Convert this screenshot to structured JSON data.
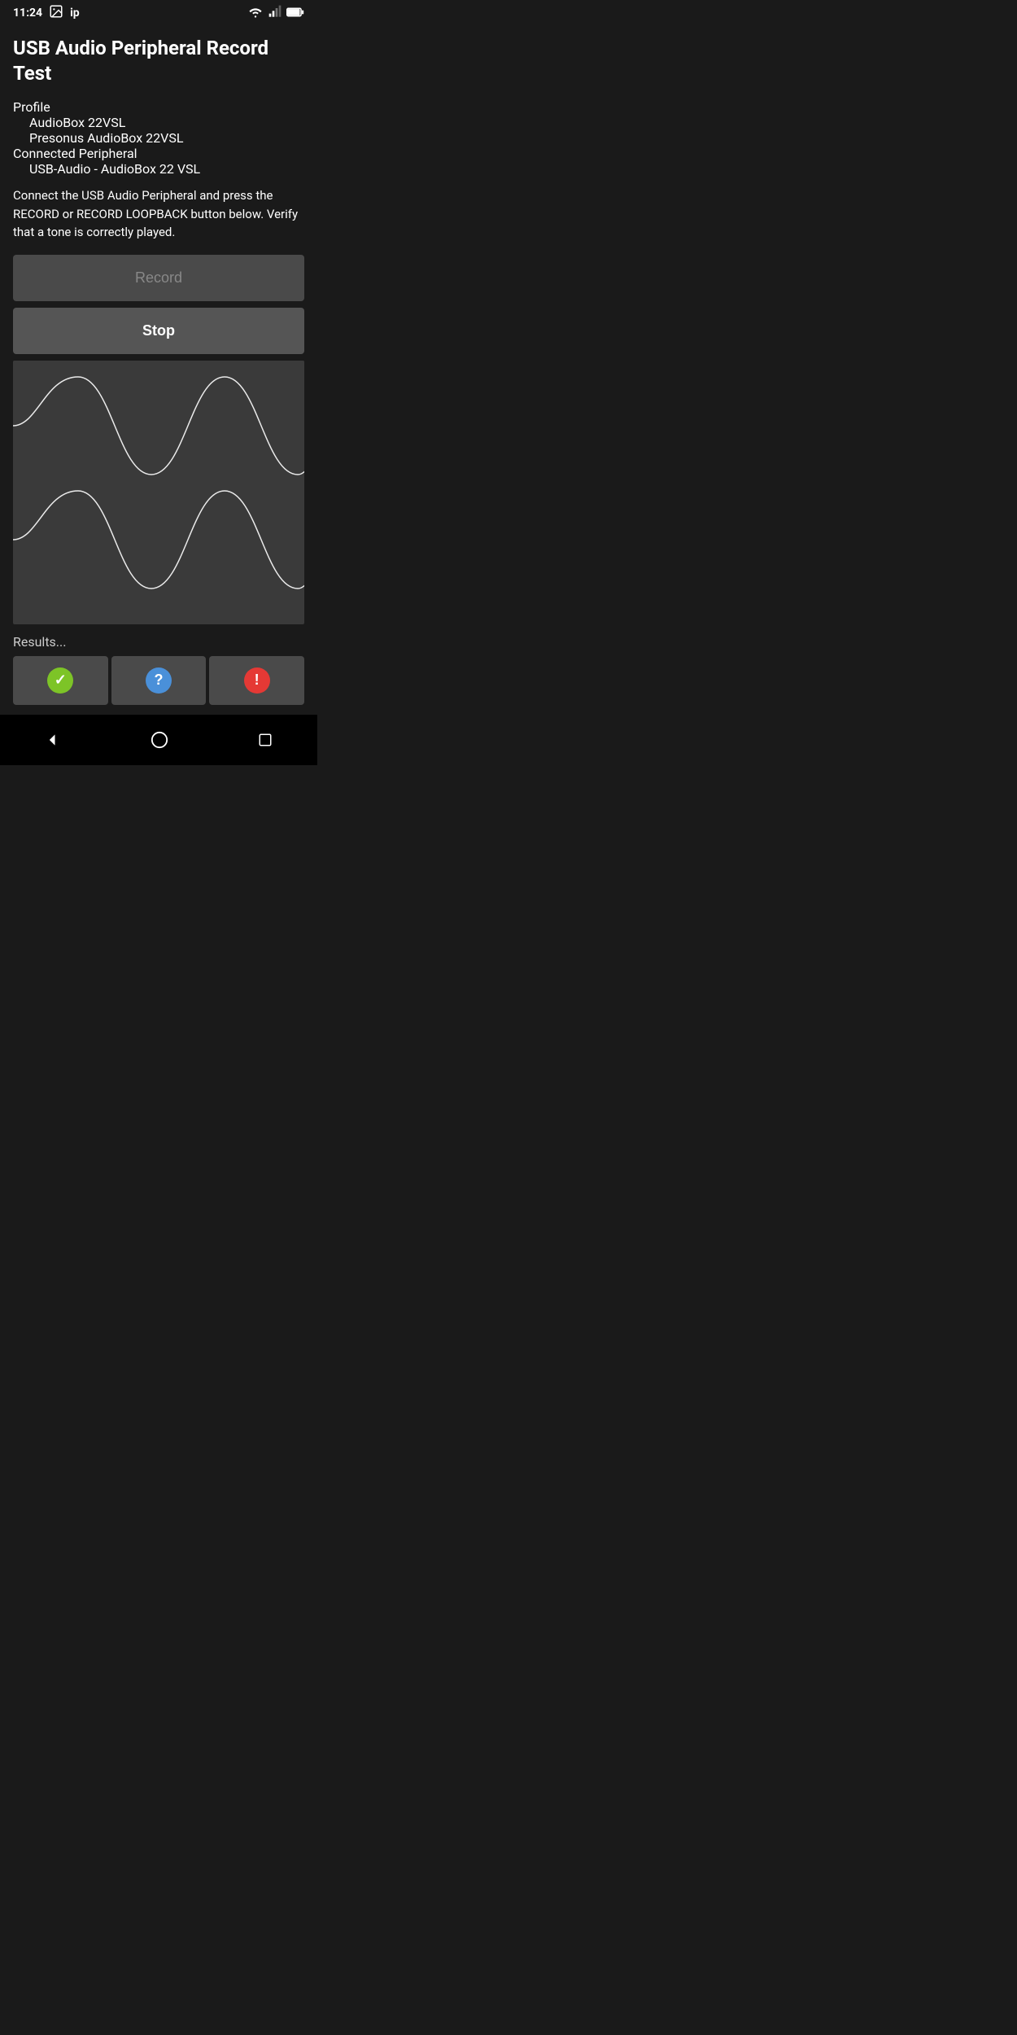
{
  "status_bar": {
    "time": "11:24",
    "notification_icon": "image",
    "network_label": "ip"
  },
  "header": {
    "title": "USB Audio Peripheral Record Test"
  },
  "profile": {
    "label": "Profile",
    "audiobox_name": "AudioBox 22VSL",
    "presonus_name": "Presonus AudioBox 22VSL"
  },
  "peripheral": {
    "label": "Connected Peripheral",
    "device_name": "USB-Audio - AudioBox 22 VSL"
  },
  "description": "Connect the USB Audio Peripheral and press the RECORD or RECORD LOOPBACK button below. Verify that a tone is correctly played.",
  "buttons": {
    "record_label": "Record",
    "stop_label": "Stop"
  },
  "results": {
    "label": "Results...",
    "btn_check_label": "✓",
    "btn_question_label": "?",
    "btn_exclaim_label": "!"
  },
  "nav": {
    "back_label": "◀",
    "home_label": "⬤",
    "recent_label": "■"
  },
  "waveform": {
    "color": "#ffffff",
    "bg": "#3a3a3a"
  }
}
